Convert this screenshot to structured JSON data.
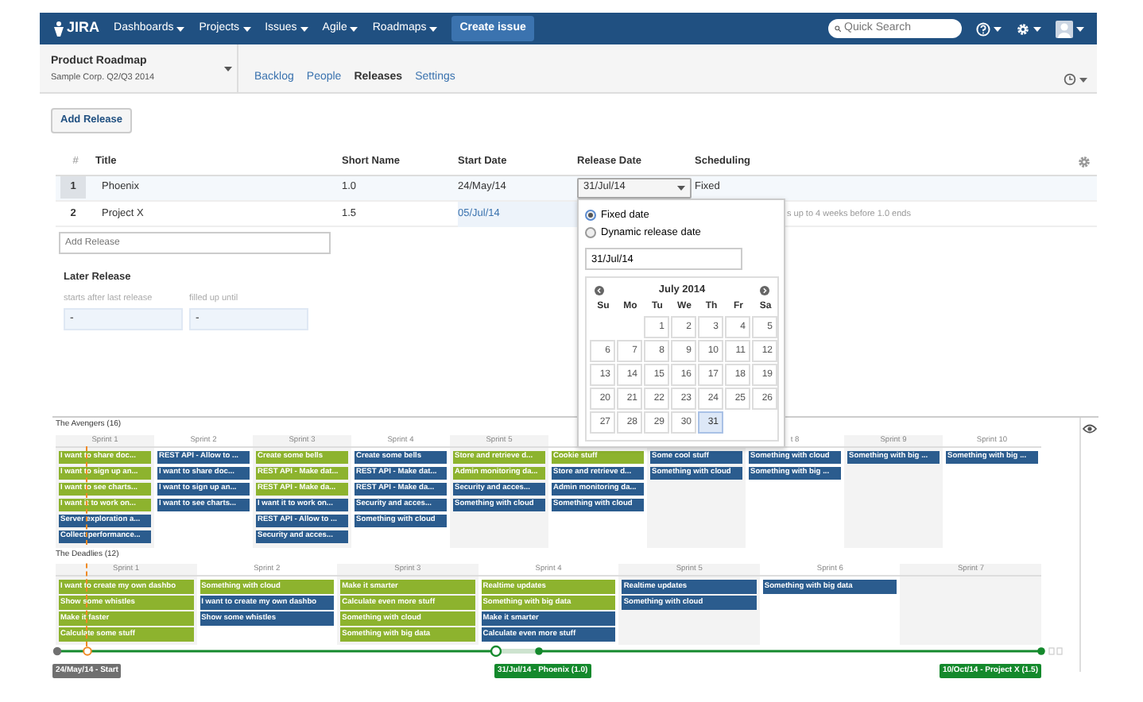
{
  "nav": {
    "logo": "JIRA",
    "menus": [
      "Dashboards",
      "Projects",
      "Issues",
      "Agile",
      "Roadmaps"
    ],
    "create_button": "Create issue",
    "search_placeholder": "Quick Search"
  },
  "project": {
    "name": "Product Roadmap",
    "subtitle": "Sample Corp. Q2/Q3 2014"
  },
  "tabs": [
    {
      "label": "Backlog",
      "selected": false
    },
    {
      "label": "People",
      "selected": false
    },
    {
      "label": "Releases",
      "selected": true
    },
    {
      "label": "Settings",
      "selected": false
    }
  ],
  "add_release_button": "Add Release",
  "table": {
    "columns": [
      "#",
      "Title",
      "Short Name",
      "Start Date",
      "Release Date",
      "Scheduling"
    ],
    "rows": [
      {
        "index": "1",
        "title": "Phoenix",
        "short_name": "1.0",
        "start_date": "24/May/14",
        "start_dynamic": false,
        "release_date": "31/Jul/14",
        "scheduling": "Fixed",
        "selected": true
      },
      {
        "index": "2",
        "title": "Project X",
        "short_name": "1.5",
        "start_date": "05/Jul/14",
        "start_dynamic": true,
        "scheduling": "s up to 4 weeks before 1.0 ends",
        "selected": false
      }
    ]
  },
  "add_release_placeholder": "Add Release",
  "later_release": {
    "title": "Later Release",
    "fields": [
      {
        "label": "starts after last release",
        "value": "-"
      },
      {
        "label": "filled up until",
        "value": "-"
      }
    ]
  },
  "date_popup": {
    "options": [
      {
        "label": "Fixed date",
        "selected": true
      },
      {
        "label": "Dynamic release date",
        "selected": false
      }
    ],
    "value": "31/Jul/14",
    "month": "July 2014",
    "weekdays": [
      "Su",
      "Mo",
      "Tu",
      "We",
      "Th",
      "Fr",
      "Sa"
    ],
    "weeks": [
      [
        {
          "day": "1",
          "selected": false
        },
        {
          "day": "2",
          "selected": false
        },
        {
          "day": "3",
          "selected": false
        },
        {
          "day": "4",
          "selected": false
        },
        {
          "day": "5",
          "selected": false
        }
      ],
      [
        {
          "day": "6",
          "selected": false
        },
        {
          "day": "7",
          "selected": false
        },
        {
          "day": "8",
          "selected": false
        },
        {
          "day": "9",
          "selected": false
        },
        {
          "day": "10",
          "selected": false
        },
        {
          "day": "11",
          "selected": false
        },
        {
          "day": "12",
          "selected": false
        }
      ],
      [
        {
          "day": "13",
          "selected": false
        },
        {
          "day": "14",
          "selected": false
        },
        {
          "day": "15",
          "selected": false
        },
        {
          "day": "16",
          "selected": false
        },
        {
          "day": "17",
          "selected": false
        },
        {
          "day": "18",
          "selected": false
        },
        {
          "day": "19",
          "selected": false
        }
      ],
      [
        {
          "day": "20",
          "selected": false
        },
        {
          "day": "21",
          "selected": false
        },
        {
          "day": "22",
          "selected": false
        },
        {
          "day": "23",
          "selected": false
        },
        {
          "day": "24",
          "selected": false
        },
        {
          "day": "25",
          "selected": false
        },
        {
          "day": "26",
          "selected": false
        }
      ],
      [
        {
          "day": "27",
          "selected": false
        },
        {
          "day": "28",
          "selected": false
        },
        {
          "day": "29",
          "selected": false
        },
        {
          "day": "30",
          "selected": false
        },
        {
          "day": "31",
          "selected": true
        }
      ]
    ]
  },
  "teams": [
    {
      "name": "The Avengers",
      "count": "(16)",
      "sprints": [
        {
          "label": "Sprint 1",
          "cards": [
            {
              "text": "I want to share doc...",
              "color": "#8db32e"
            },
            {
              "text": "I want to sign up an...",
              "color": "#8db32e"
            },
            {
              "text": "I want to see charts...",
              "color": "#8db32e"
            },
            {
              "text": "I want it to work on...",
              "color": "#8db32e"
            },
            {
              "text": "Server exploration a...",
              "color": "#2b5c8e"
            },
            {
              "text": "Collect performance...",
              "color": "#2b5c8e"
            }
          ]
        },
        {
          "label": "Sprint 2",
          "cards": [
            {
              "text": "REST API - Allow to ...",
              "color": "#2b5c8e"
            },
            {
              "text": "I want to share doc...",
              "color": "#2b5c8e"
            },
            {
              "text": "I want to sign up an...",
              "color": "#2b5c8e"
            },
            {
              "text": "I want to see charts...",
              "color": "#2b5c8e"
            }
          ]
        },
        {
          "label": "Sprint 3",
          "cards": [
            {
              "text": "Create some bells",
              "color": "#8db32e"
            },
            {
              "text": "REST API - Make dat...",
              "color": "#8db32e"
            },
            {
              "text": "REST API - Make da...",
              "color": "#8db32e"
            },
            {
              "text": "I want it to work on...",
              "color": "#2b5c8e"
            },
            {
              "text": "REST API - Allow to ...",
              "color": "#2b5c8e"
            },
            {
              "text": "Security and acces...",
              "color": "#2b5c8e"
            }
          ]
        },
        {
          "label": "Sprint 4",
          "cards": [
            {
              "text": "Create some bells",
              "color": "#2b5c8e"
            },
            {
              "text": "REST API - Make dat...",
              "color": "#2b5c8e"
            },
            {
              "text": "REST API - Make da...",
              "color": "#2b5c8e"
            },
            {
              "text": "Security and acces...",
              "color": "#2b5c8e"
            },
            {
              "text": "Something with cloud",
              "color": "#2b5c8e"
            }
          ]
        },
        {
          "label": "Sprint 5",
          "cards": [
            {
              "text": "Store and retrieve d...",
              "color": "#8db32e"
            },
            {
              "text": "Admin monitoring da...",
              "color": "#8db32e"
            },
            {
              "text": "Security and acces...",
              "color": "#2b5c8e"
            },
            {
              "text": "Something with cloud",
              "color": "#2b5c8e"
            }
          ]
        },
        {
          "cards": [
            {
              "text": "Cookie stuff",
              "color": "#8db32e"
            },
            {
              "text": "Store and retrieve d...",
              "color": "#2b5c8e"
            },
            {
              "text": "Admin monitoring da...",
              "color": "#2b5c8e"
            },
            {
              "text": "Something with cloud",
              "color": "#2b5c8e"
            }
          ]
        },
        {
          "cards": [
            {
              "text": "Some cool stuff",
              "color": "#2b5c8e"
            },
            {
              "text": "Something with cloud",
              "color": "#2b5c8e"
            }
          ]
        },
        {
          "label": "t 8",
          "cards": [
            {
              "text": "Something with cloud",
              "color": "#2b5c8e"
            },
            {
              "text": "Something with big ...",
              "color": "#2b5c8e"
            }
          ]
        },
        {
          "label": "Sprint 9",
          "cards": [
            {
              "text": "Something with big ...",
              "color": "#2b5c8e"
            }
          ]
        },
        {
          "label": "Sprint 10",
          "cards": [
            {
              "text": "Something with big ...",
              "color": "#2b5c8e"
            }
          ]
        }
      ]
    },
    {
      "name": "The Deadlies",
      "count": "(12)",
      "sprints": [
        {
          "label": "Sprint 1",
          "cards": [
            {
              "text": "I want to create my own dashbo",
              "color": "#8db32e"
            },
            {
              "text": "Show some whistles",
              "color": "#8db32e"
            },
            {
              "text": "Make it faster",
              "color": "#8db32e"
            },
            {
              "text": "Calculate some stuff",
              "color": "#8db32e"
            }
          ]
        },
        {
          "label": "Sprint 2",
          "cards": [
            {
              "text": "Something with cloud",
              "color": "#8db32e"
            },
            {
              "text": "I want to create my own dashbo",
              "color": "#2b5c8e"
            },
            {
              "text": "Show some whistles",
              "color": "#2b5c8e"
            }
          ]
        },
        {
          "label": "Sprint 3",
          "cards": [
            {
              "text": "Make it smarter",
              "color": "#8db32e"
            },
            {
              "text": "Calculate even more stuff",
              "color": "#8db32e"
            },
            {
              "text": "Something with cloud",
              "color": "#8db32e"
            },
            {
              "text": "Something with big data",
              "color": "#8db32e"
            }
          ]
        },
        {
          "label": "Sprint 4",
          "cards": [
            {
              "text": "Realtime updates",
              "color": "#8db32e"
            },
            {
              "text": "Something with big data",
              "color": "#8db32e"
            },
            {
              "text": "Make it smarter",
              "color": "#2b5c8e"
            },
            {
              "text": "Calculate even more stuff",
              "color": "#2b5c8e"
            }
          ]
        },
        {
          "label": "Sprint 5",
          "cards": [
            {
              "text": "Realtime updates",
              "color": "#2b5c8e"
            },
            {
              "text": "Something with cloud",
              "color": "#2b5c8e"
            }
          ]
        },
        {
          "label": "Sprint 6",
          "cards": [
            {
              "text": "Something with big data",
              "color": "#2b5c8e"
            }
          ]
        },
        {
          "label": "Sprint 7"
        }
      ]
    }
  ],
  "milestones": [
    {
      "label": "24/May/14 - Start",
      "color": "#707070"
    },
    {
      "label": "31/Jul/14 - Phoenix (1.0)",
      "color": "#14892c"
    },
    {
      "label": "10/Oct/14 - Project X (1.5)",
      "color": "#14892c"
    }
  ]
}
